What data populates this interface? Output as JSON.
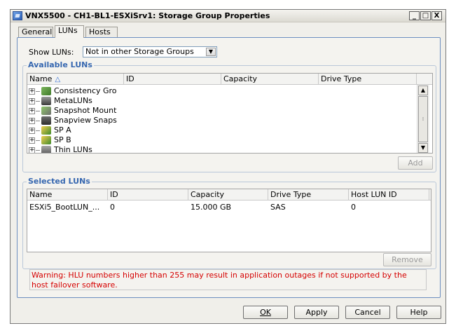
{
  "window": {
    "title": "VNX5500 - CH1-BL1-ESXiSrv1: Storage Group Properties"
  },
  "title_buttons": {
    "minimize": "_",
    "maximize": "□",
    "close": "X"
  },
  "tabs": [
    {
      "label": "General"
    },
    {
      "label": "LUNs",
      "active": true
    },
    {
      "label": "Hosts"
    }
  ],
  "show_luns": {
    "label": "Show LUNs:",
    "selected": "Not in other Storage Groups"
  },
  "available_luns": {
    "title": "Available LUNs",
    "columns": [
      "Name",
      "ID",
      "Capacity",
      "Drive Type"
    ],
    "sort_icon": "sort-ascending-icon",
    "items": [
      {
        "label": "Consistency Gro",
        "icon": "consistency-group-icon"
      },
      {
        "label": "MetaLUNs",
        "icon": "metalun-icon"
      },
      {
        "label": "Snapshot Mount",
        "icon": "snapshot-mount-icon"
      },
      {
        "label": "Snapview Snaps",
        "icon": "snapview-icon"
      },
      {
        "label": "SP A",
        "icon": "storage-processor-icon"
      },
      {
        "label": "SP B",
        "icon": "storage-processor-icon"
      },
      {
        "label": "Thin LUNs",
        "icon": "thin-lun-icon"
      }
    ],
    "add_button": "Add"
  },
  "selected_luns": {
    "title": "Selected LUNs",
    "columns": [
      "Name",
      "ID",
      "Capacity",
      "Drive Type",
      "Host LUN ID"
    ],
    "rows": [
      [
        "ESXi5_BootLUN_...",
        "0",
        "15.000 GB",
        "SAS",
        "0"
      ]
    ],
    "remove_button": "Remove"
  },
  "warning": "Warning: HLU numbers higher than 255 may result in application outages if not supported by the host failover software.",
  "buttons": {
    "ok": "OK",
    "apply": "Apply",
    "cancel": "Cancel",
    "help": "Help"
  }
}
